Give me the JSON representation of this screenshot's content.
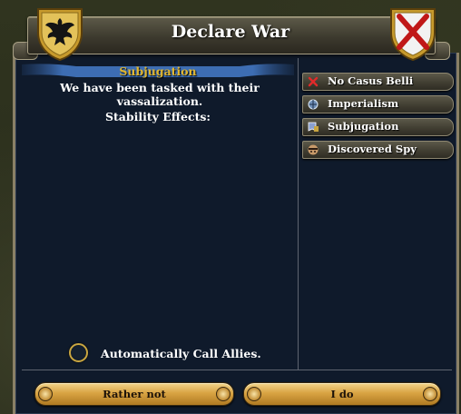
{
  "dialog": {
    "title": "Declare War"
  },
  "casus_belli_detail": {
    "name": "Subjugation",
    "description": "We have been tasked with their vassalization.",
    "stability_label": "Stability Effects:"
  },
  "casus_belli_list": [
    {
      "label": "No Casus Belli",
      "icon": "red-x-icon"
    },
    {
      "label": "Imperialism",
      "icon": "imperialism-icon"
    },
    {
      "label": "Subjugation",
      "icon": "subjugation-icon"
    },
    {
      "label": "Discovered Spy",
      "icon": "spy-icon"
    }
  ],
  "options": {
    "call_allies_label": "Automatically Call Allies.",
    "call_allies_checked": false
  },
  "buttons": {
    "cancel_label": "Rather not",
    "confirm_label": "I do"
  },
  "colors": {
    "panel_bg": "#0f1a2b",
    "title_gold": "#e0b630",
    "button_gold": "#d9a443"
  }
}
